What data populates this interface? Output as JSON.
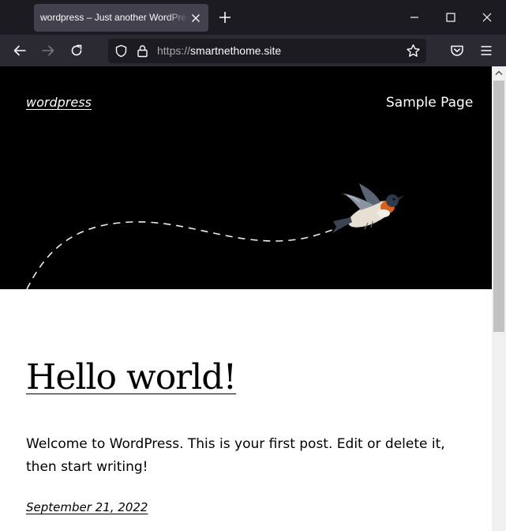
{
  "browser": {
    "tab": {
      "title": "wordpress – Just another WordPress site"
    },
    "url": {
      "scheme": "https://",
      "host": "smartnethome.site"
    }
  },
  "site": {
    "title": "wordpress",
    "nav": [
      {
        "label": "Sample Page"
      }
    ]
  },
  "post": {
    "title": "Hello world!",
    "body": "Welcome to WordPress. This is your first post. Edit or delete it, then start writing!",
    "date": "September 21, 2022"
  },
  "colors": {
    "tab_strip": "#1c1b22",
    "toolbar": "#2b2a33",
    "active_tab": "#42414d",
    "hero_background": "#000000",
    "page_background": "#ffffff"
  },
  "icons": {
    "tab": [
      "close-icon",
      "plus-icon"
    ],
    "window": [
      "minimize-icon",
      "maximize-icon",
      "window-close-icon"
    ],
    "nav": [
      "back-arrow-icon",
      "forward-arrow-icon",
      "reload-icon",
      "shield-icon",
      "lock-icon",
      "star-icon",
      "pocket-icon",
      "hamburger-menu-icon"
    ]
  }
}
